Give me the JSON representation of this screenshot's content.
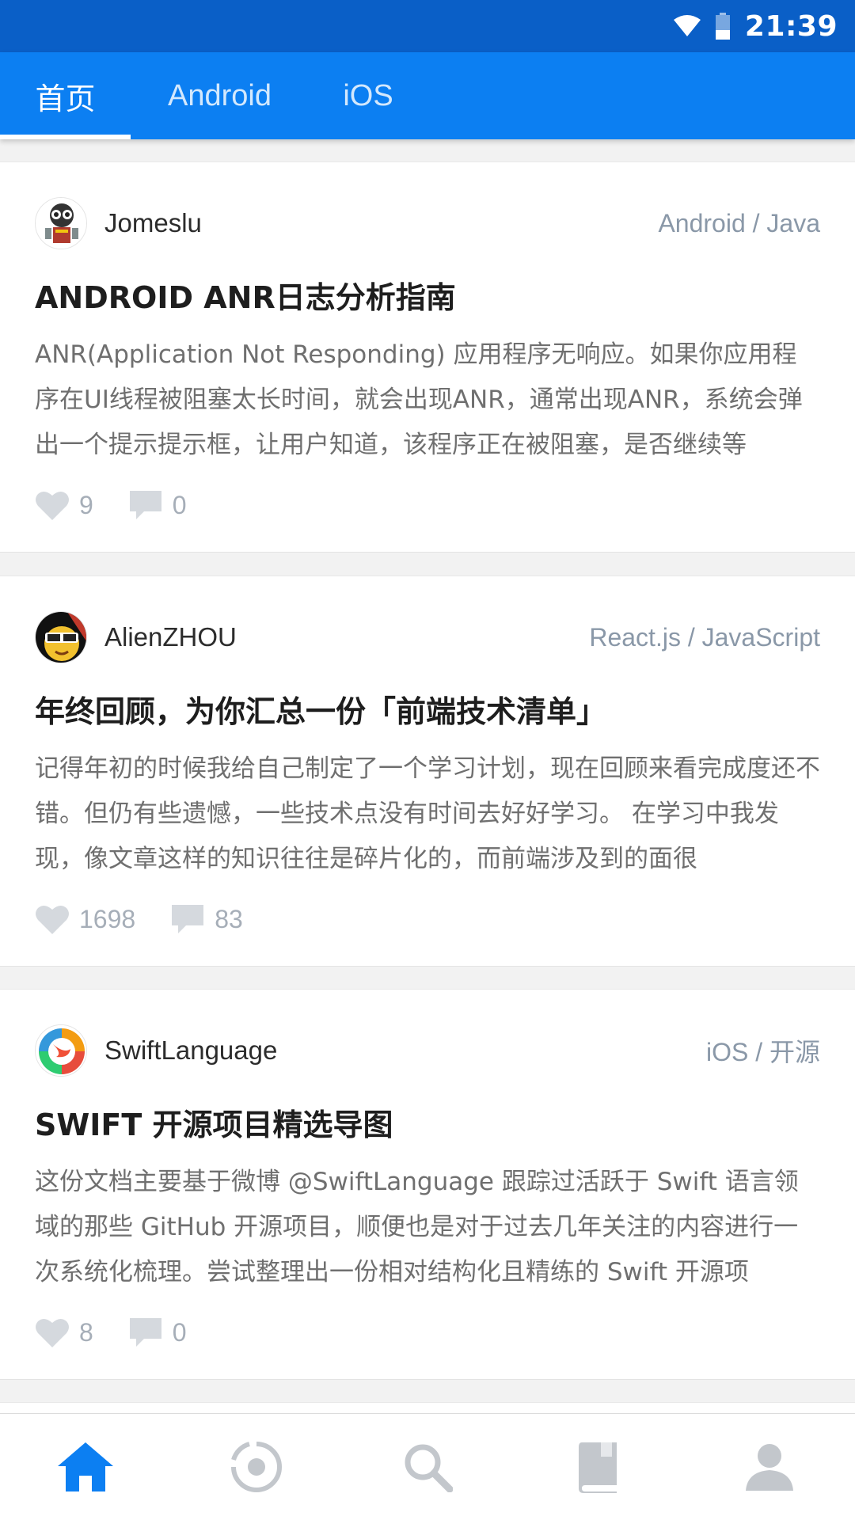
{
  "status_bar": {
    "time": "21:39"
  },
  "colors": {
    "status_bar": "#0a5fc7",
    "app_bar": "#0c7ff2",
    "accent": "#0c7ff2",
    "inactive_icon": "#c3c7cc"
  },
  "tabs": [
    {
      "label": "首页",
      "active": true
    },
    {
      "label": "Android",
      "active": false
    },
    {
      "label": "iOS",
      "active": false
    }
  ],
  "posts": [
    {
      "author": "Jomeslu",
      "tags": "Android / Java",
      "title": "ANDROID ANR日志分析指南",
      "excerpt": "ANR(Application Not Responding) 应用程序无响应。如果你应用程序在UI线程被阻塞太长时间，就会出现ANR，通常出现ANR，系统会弹出一个提示提示框，让用户知道，该程序正在被阻塞，是否继续等",
      "likes": "9",
      "comments": "0",
      "avatar_icon": "robot-avatar"
    },
    {
      "author": "AlienZHOU",
      "tags": "React.js / JavaScript",
      "title": "年终回顾，为你汇总一份「前端技术清单」",
      "excerpt": "记得年初的时候我给自己制定了一个学习计划，现在回顾来看完成度还不错。但仍有些遗憾，一些技术点没有时间去好好学习。 在学习中我发现，像文章这样的知识往往是碎片化的，而前端涉及到的面很",
      "likes": "1698",
      "comments": "83",
      "avatar_icon": "sunglasses-avatar"
    },
    {
      "author": "SwiftLanguage",
      "tags": "iOS / 开源",
      "title": "SWIFT 开源项目精选导图",
      "excerpt": "这份文档主要基于微博 @SwiftLanguage 跟踪过活跃于 Swift 语言领域的那些 GitHub 开源项目，顺便也是对于过去几年关注的内容进行一次系统化梳理。尝试整理出一份相对结构化且精练的 Swift 开源项",
      "likes": "8",
      "comments": "0",
      "avatar_icon": "swift-logo-avatar"
    }
  ],
  "bottom_nav": [
    {
      "icon": "home-icon",
      "active": true
    },
    {
      "icon": "hot-icon",
      "active": false
    },
    {
      "icon": "search-icon",
      "active": false
    },
    {
      "icon": "book-icon",
      "active": false
    },
    {
      "icon": "profile-icon",
      "active": false
    }
  ]
}
